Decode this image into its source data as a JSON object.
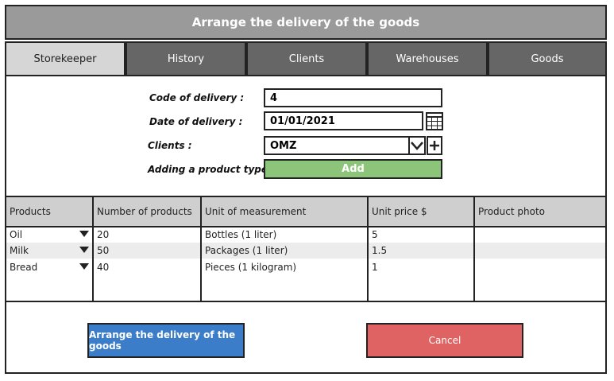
{
  "window": {
    "title": "Arrange the delivery of the goods"
  },
  "tabs": [
    {
      "label": "Storekeeper",
      "active": true
    },
    {
      "label": "History",
      "active": false
    },
    {
      "label": "Clients",
      "active": false
    },
    {
      "label": "Warehouses",
      "active": false
    },
    {
      "label": "Goods",
      "active": false
    }
  ],
  "form": {
    "code_label": "Code of delivery :",
    "code_value": "4",
    "date_label": "Date of delivery :",
    "date_value": "01/01/2021",
    "clients_label": "Clients :",
    "clients_value": "OMZ",
    "product_type_label": "Adding a product type :",
    "add_button_label": "Add",
    "icons": {
      "date": "calendar-icon",
      "clients_dropdown": "chevron-down-icon",
      "clients_add": "plus-icon"
    }
  },
  "table": {
    "headers": {
      "products": "Products",
      "number": "Number of products",
      "unit": "Unit of measurement",
      "price": "Unit price $",
      "photo": "Product photo"
    },
    "rows": [
      {
        "product": "Oil",
        "number": "20",
        "unit": "Bottles (1 liter)",
        "price": "5",
        "photo": ""
      },
      {
        "product": "Milk",
        "number": "50",
        "unit": "Packages (1 liter)",
        "price": "1.5",
        "photo": ""
      },
      {
        "product": "Bread",
        "number": "40",
        "unit": "Pieces (1 kilogram)",
        "price": "1",
        "photo": ""
      }
    ]
  },
  "actions": {
    "submit_label": "Arrange the delivery of the goods",
    "cancel_label": "Cancel"
  },
  "colors": {
    "titlebar": "#9a9a9a",
    "tab_inactive": "#666666",
    "tab_active": "#d6d6d6",
    "add_button": "#8cc57a",
    "submit_button": "#3b7dc9",
    "cancel_button": "#e06363"
  }
}
